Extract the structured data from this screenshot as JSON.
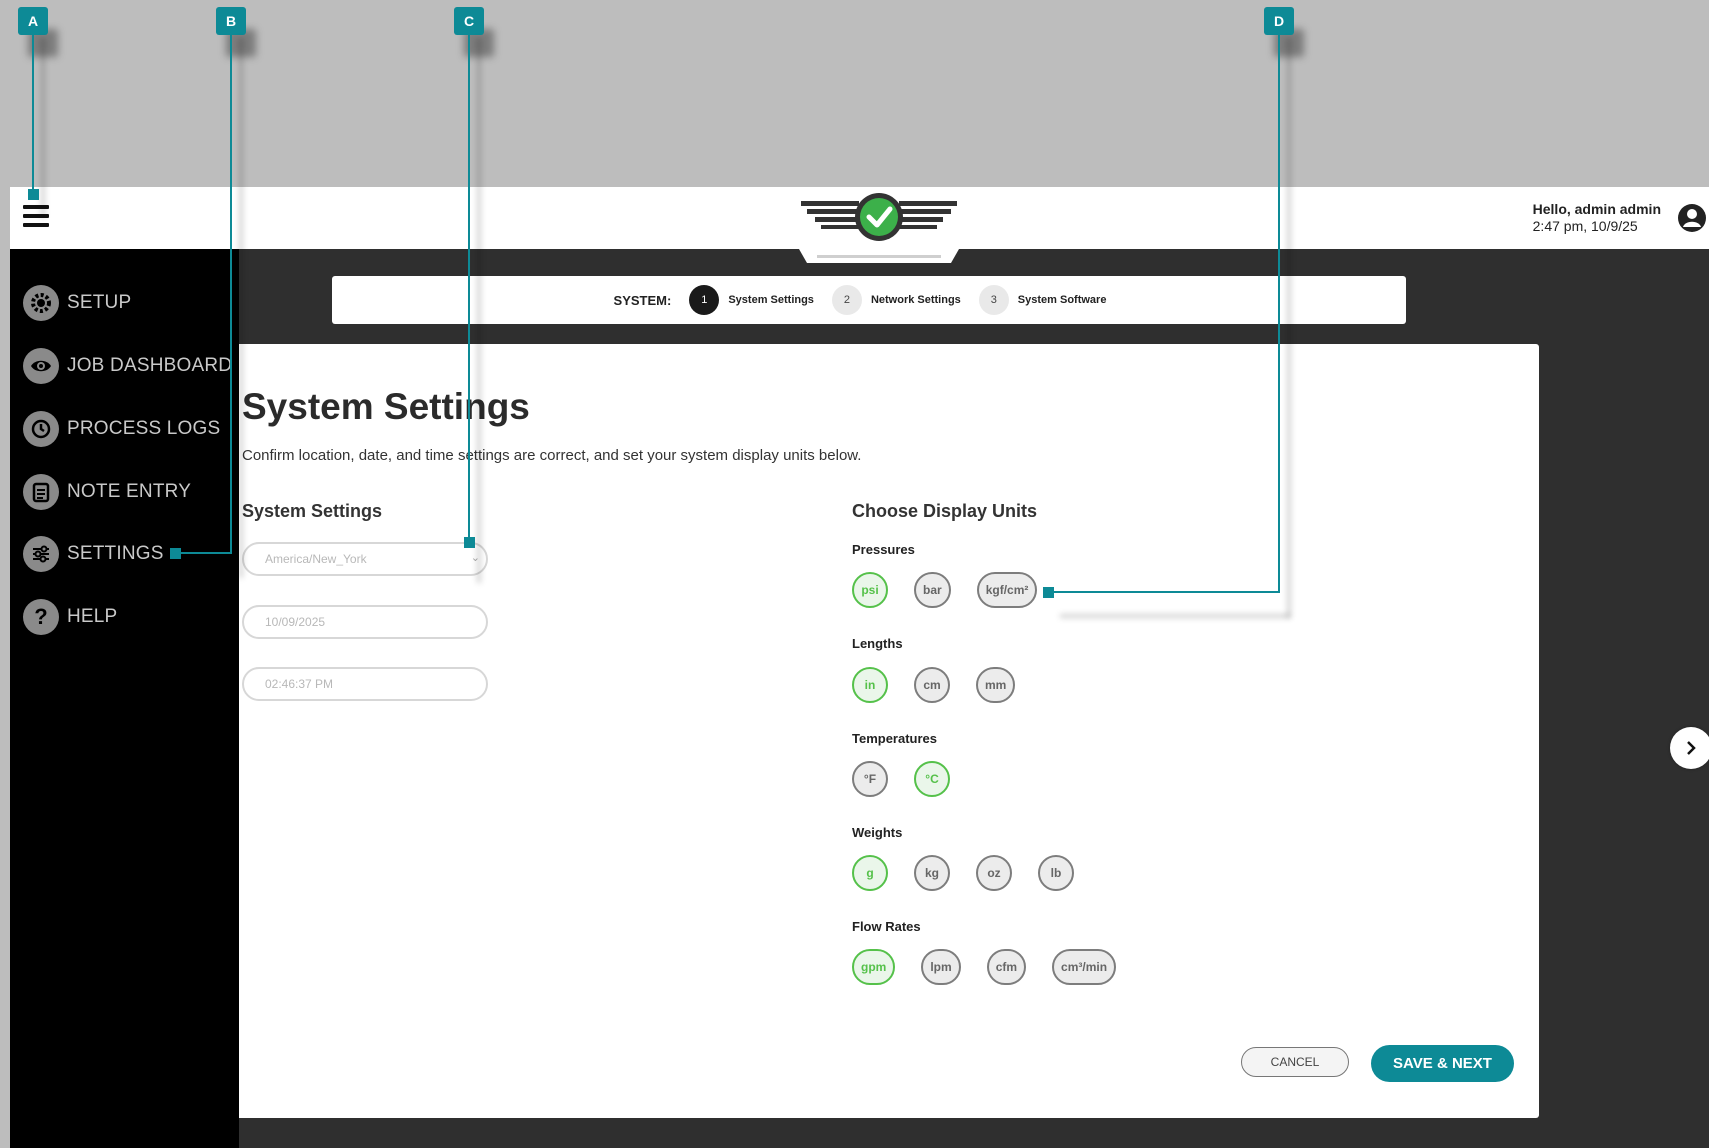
{
  "callouts": [
    "A",
    "B",
    "C",
    "D"
  ],
  "header": {
    "greeting": "Hello, admin admin",
    "datetime": "2:47 pm, 10/9/25"
  },
  "sidebar": {
    "items": [
      {
        "label": "SETUP",
        "icon": "gear-icon"
      },
      {
        "label": "JOB DASHBOARD",
        "icon": "eye-icon"
      },
      {
        "label": "PROCESS LOGS",
        "icon": "history-icon"
      },
      {
        "label": "NOTE ENTRY",
        "icon": "clipboard-icon"
      },
      {
        "label": "SETTINGS",
        "icon": "sliders-icon"
      },
      {
        "label": "HELP",
        "icon": "help-icon"
      }
    ]
  },
  "stepper": {
    "prefix": "SYSTEM:",
    "steps": [
      {
        "num": "1",
        "label": "System Settings",
        "active": true
      },
      {
        "num": "2",
        "label": "Network Settings",
        "active": false
      },
      {
        "num": "3",
        "label": "System Software",
        "active": false
      }
    ]
  },
  "page": {
    "title": "System Settings",
    "subtitle": "Confirm location, date, and time settings are correct, and set your system display units below."
  },
  "system_settings": {
    "title": "System Settings",
    "timezone": "America/New_York",
    "date": "10/09/2025",
    "time": "02:46:37 PM"
  },
  "display_units": {
    "title": "Choose Display Units",
    "groups": [
      {
        "label": "Pressures",
        "options": [
          "psi",
          "bar",
          "kgf/cm²"
        ],
        "selected": "psi"
      },
      {
        "label": "Lengths",
        "options": [
          "in",
          "cm",
          "mm"
        ],
        "selected": "in"
      },
      {
        "label": "Temperatures",
        "options": [
          "°F",
          "°C"
        ],
        "selected": "°C"
      },
      {
        "label": "Weights",
        "options": [
          "g",
          "kg",
          "oz",
          "lb"
        ],
        "selected": "g"
      },
      {
        "label": "Flow Rates",
        "options": [
          "gpm",
          "lpm",
          "cfm",
          "cm³/min"
        ],
        "selected": "gpm"
      }
    ]
  },
  "actions": {
    "cancel": "CANCEL",
    "save": "SAVE & NEXT"
  },
  "colors": {
    "accent": "#0d8a96",
    "selected": "#55c14a",
    "sidebar_bg": "#000000"
  }
}
